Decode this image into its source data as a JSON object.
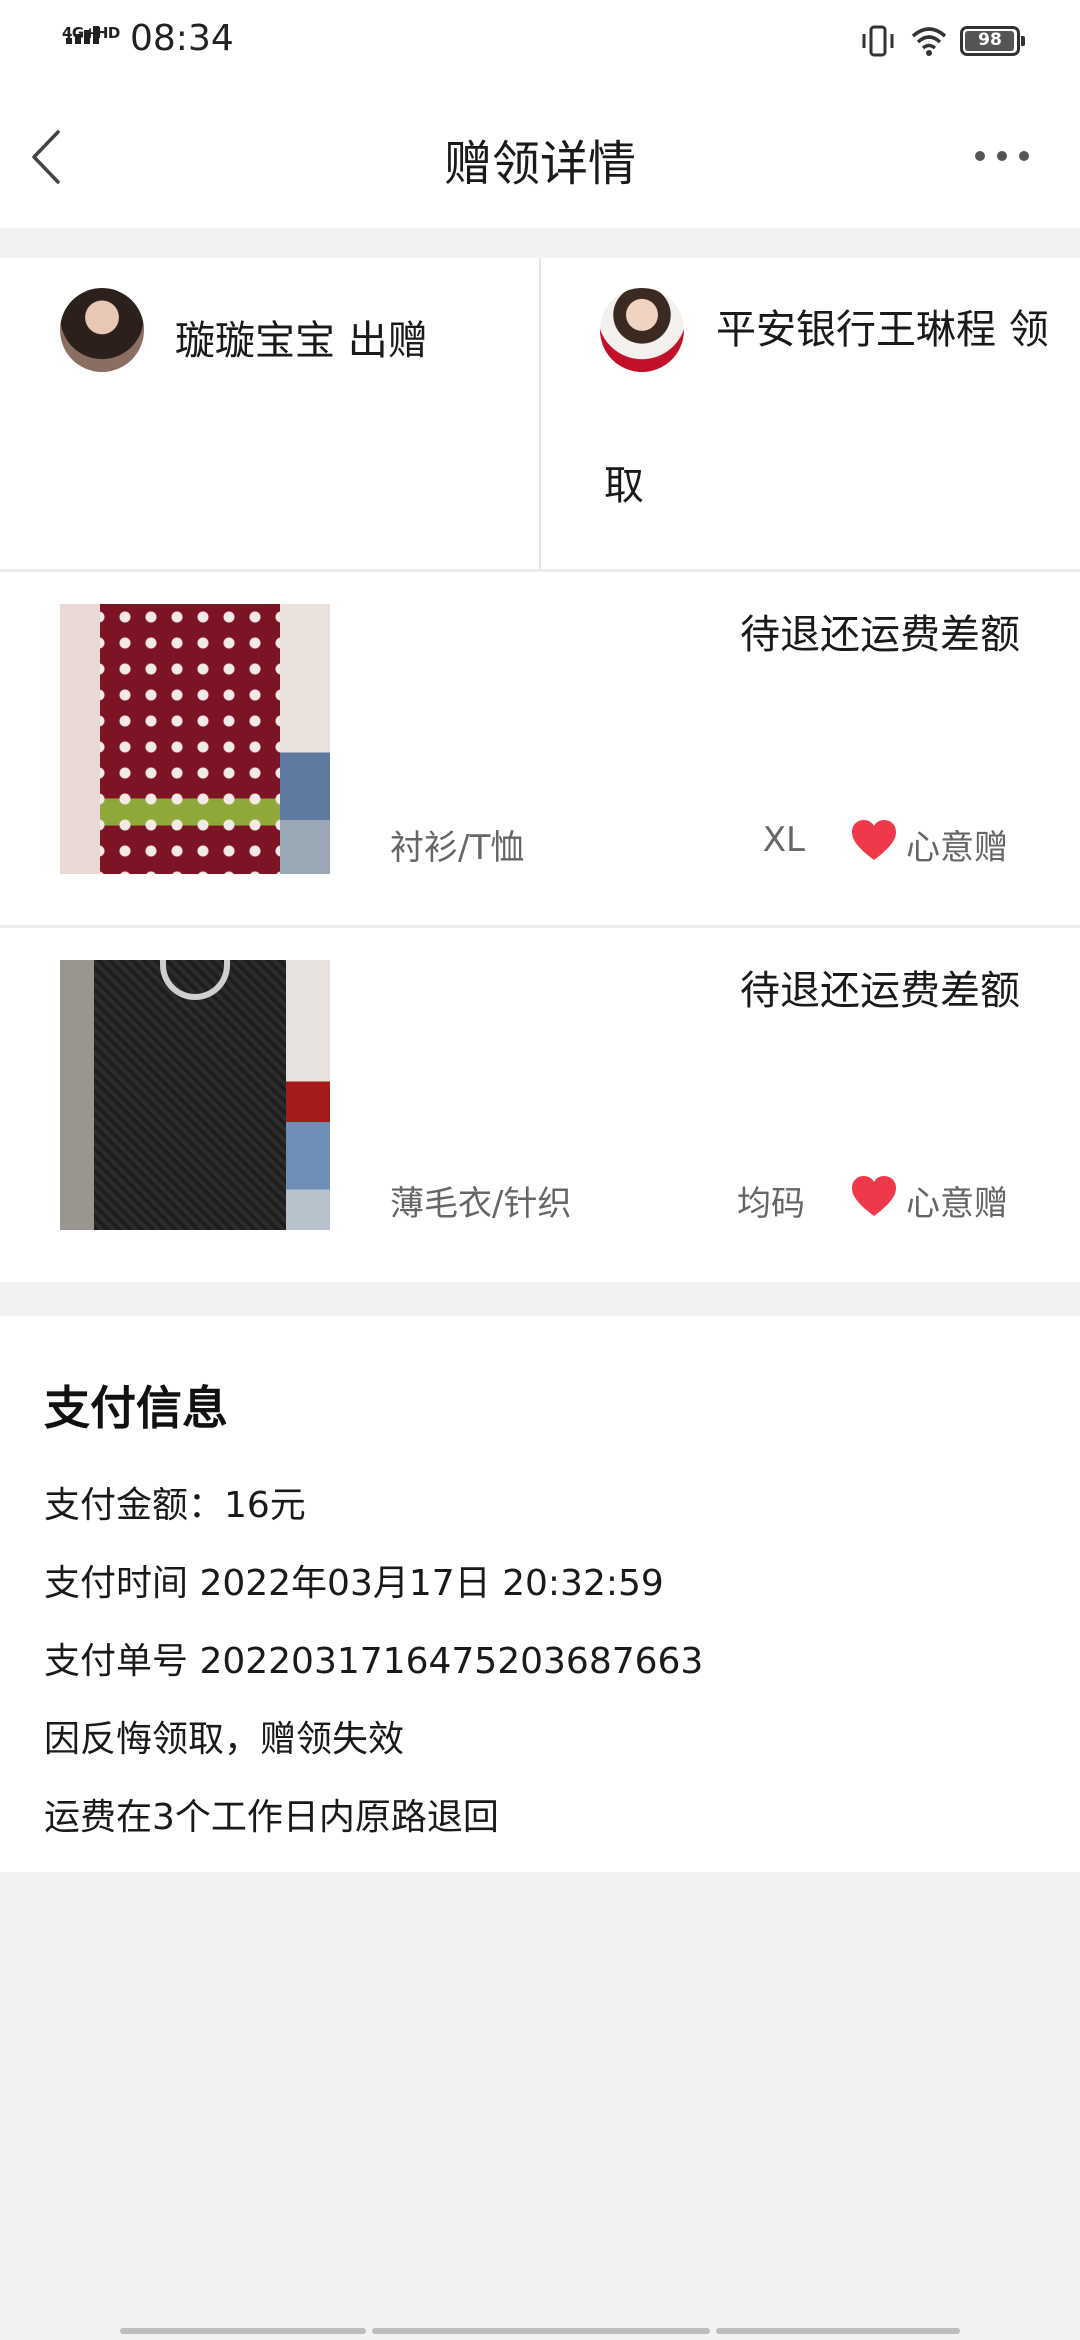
{
  "status_bar": {
    "network": "4G+HD",
    "time": "08:34",
    "battery": "98",
    "battery_level": 0.98
  },
  "header": {
    "title": "赠领详情",
    "back_icon": "chevron-left-icon",
    "more_icon": "more-dots-icon"
  },
  "parties": {
    "giver_name": "璇璇宝宝",
    "giver_action": "出赠",
    "receiver_name": "平安银行王琳程",
    "receiver_action": "领取"
  },
  "items": [
    {
      "status": "待退还运费差额",
      "category": "衬衫/T恤",
      "size": "XL",
      "gift_type": "心意赠"
    },
    {
      "status": "待退还运费差额",
      "category": "薄毛衣/针织",
      "size": "均码",
      "gift_type": "心意赠"
    }
  ],
  "payment": {
    "title": "支付信息",
    "amount_line": "支付金额：16元",
    "time_line": "支付时间 2022年03月17日 20:32:59",
    "order_line": "支付单号 2022031716475203687663",
    "status_line": "因反悔领取，赠领失效",
    "refund_line": "运费在3个工作日内原路退回"
  },
  "colors": {
    "heart": "#f0384b",
    "background": "#f2f2f2",
    "card": "#ffffff"
  }
}
